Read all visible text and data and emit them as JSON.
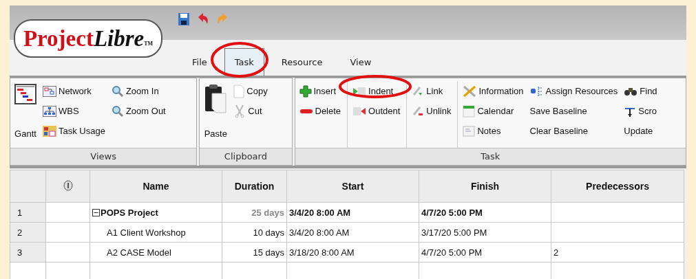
{
  "app": {
    "logo": "Project",
    "logo_emphasis": "Libre",
    "logo_mark": "TM"
  },
  "menu_tabs": [
    {
      "label": "File",
      "selected": false
    },
    {
      "label": "Task",
      "selected": true
    },
    {
      "label": "Resource",
      "selected": false
    },
    {
      "label": "View",
      "selected": false
    }
  ],
  "ribbon_groups": [
    {
      "label": "Views",
      "columns": [
        [
          {
            "label": "Gantt",
            "kind": "large"
          }
        ],
        [
          {
            "label": "Network",
            "kind": "small"
          },
          {
            "label": "WBS",
            "kind": "small"
          },
          {
            "label": "Task Usage",
            "kind": "small"
          }
        ],
        [
          {
            "label": "Zoom In",
            "kind": "small"
          },
          {
            "label": "Zoom Out",
            "kind": "small"
          }
        ]
      ]
    },
    {
      "label": "Clipboard",
      "columns": [
        [
          {
            "label": "Paste",
            "kind": "large"
          }
        ],
        [
          {
            "label": "Copy",
            "kind": "small"
          },
          {
            "label": "Cut",
            "kind": "small"
          }
        ]
      ]
    },
    {
      "label": "Task",
      "columns": [
        [
          {
            "label": "Insert",
            "kind": "small"
          },
          {
            "label": "Delete",
            "kind": "small"
          }
        ],
        [
          {
            "label": "Indent",
            "kind": "small"
          },
          {
            "label": "Outdent",
            "kind": "small"
          }
        ],
        [
          {
            "label": "Link",
            "kind": "small"
          },
          {
            "label": "Unlink",
            "kind": "small"
          }
        ],
        [
          {
            "label": "Information",
            "kind": "small"
          },
          {
            "label": "Calendar",
            "kind": "small"
          },
          {
            "label": "Notes",
            "kind": "small"
          }
        ],
        [
          {
            "label": "Assign Resources",
            "kind": "small"
          },
          {
            "label": "Save Baseline",
            "kind": "text"
          },
          {
            "label": "Clear Baseline",
            "kind": "text"
          }
        ],
        [
          {
            "label": "Find",
            "kind": "small"
          },
          {
            "label": "Scro",
            "kind": "small"
          },
          {
            "label": "Update",
            "kind": "text"
          }
        ]
      ]
    }
  ],
  "table": {
    "columns": [
      "Name",
      "Duration",
      "Start",
      "Finish",
      "Predecessors"
    ],
    "rows": [
      {
        "number": "1",
        "name": "POPS Project",
        "duration": "25 days",
        "start": "3/4/20 8:00 AM",
        "finish": "4/7/20 5:00 PM",
        "predecessors": "",
        "summary": true,
        "expanded": true
      },
      {
        "number": "2",
        "name": "A1 Client Workshop",
        "duration": "10 days",
        "start": "3/4/20 8:00 AM",
        "finish": "3/17/20 5:00 PM",
        "predecessors": "",
        "summary": false
      },
      {
        "number": "3",
        "name": "A2 CASE Model",
        "duration": "15 days",
        "start": "3/18/20 8:00 AM",
        "finish": "4/7/20 5:00 PM",
        "predecessors": "2",
        "summary": false
      }
    ]
  }
}
